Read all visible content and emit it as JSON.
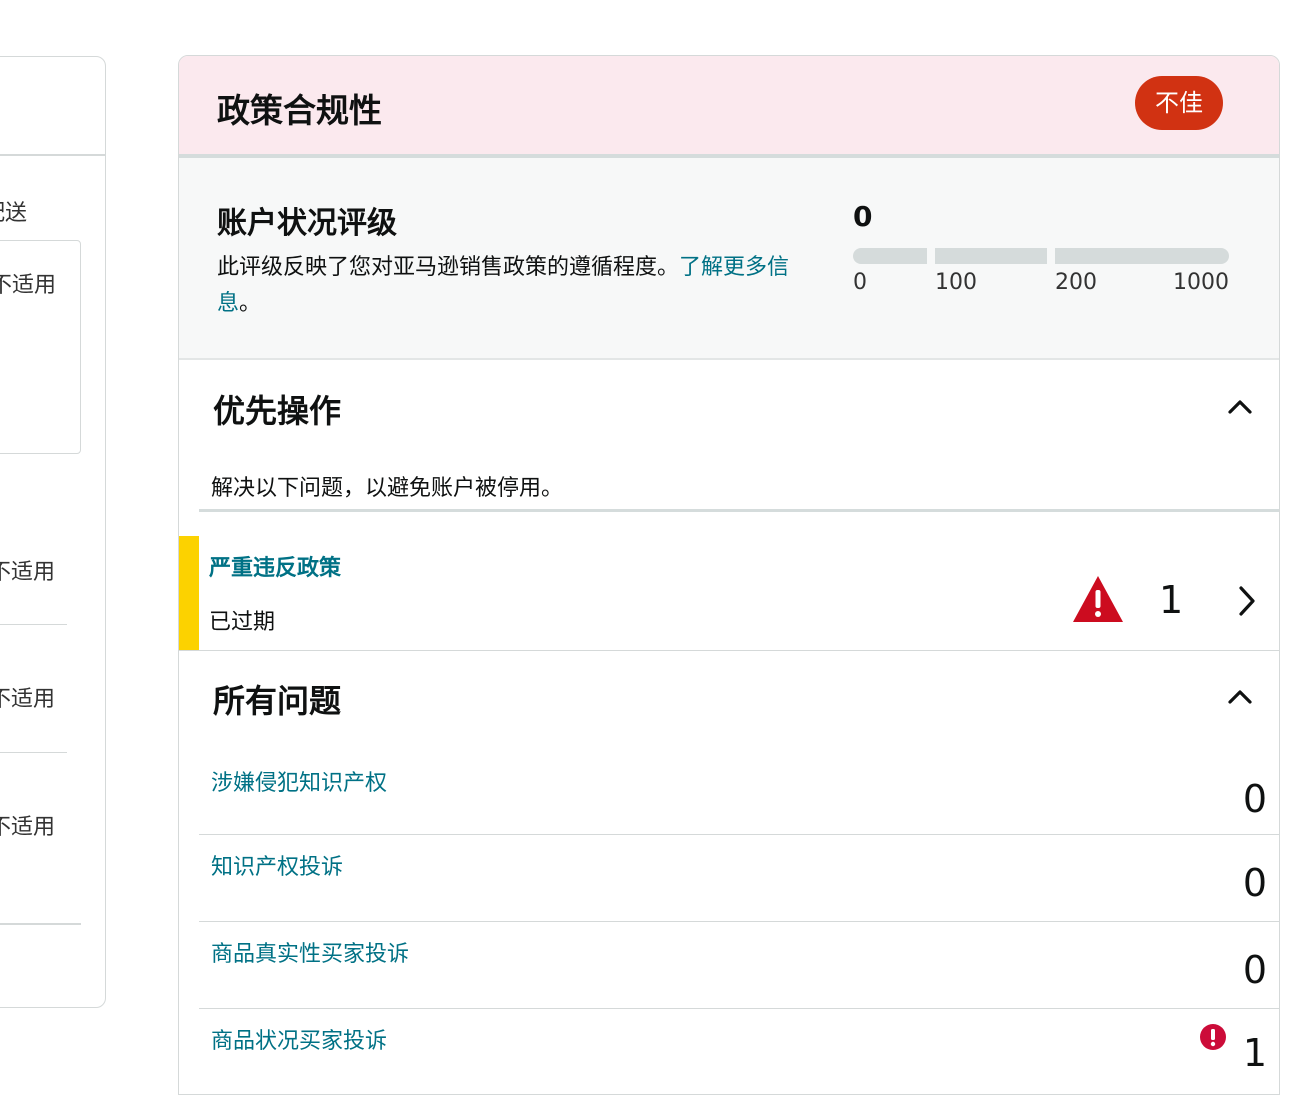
{
  "left_panel": {
    "labels": [
      "逊配送",
      "不适用",
      "不适用",
      "不适用",
      "不适用"
    ]
  },
  "policy": {
    "title": "政策合规性",
    "status_badge": "不佳",
    "status_color": "#d13212"
  },
  "rating": {
    "title": "账户状况评级",
    "description": "此评级反映了您对亚马逊销售政策的遵循程度。",
    "link_text": "了解更多信息",
    "link_suffix": "。",
    "score": "0",
    "ticks": [
      "0",
      "100",
      "200",
      "1000"
    ]
  },
  "priority": {
    "title": "优先操作",
    "description": "解决以下问题，以避免账户被停用。",
    "item": {
      "label": "严重违反政策",
      "status": "已过期",
      "count": "1",
      "icon": "warning-triangle-icon",
      "accent_color": "#fcd200"
    }
  },
  "all_issues": {
    "title": "所有问题",
    "items": [
      {
        "label": "涉嫌侵犯知识产权",
        "value": "0"
      },
      {
        "label": "知识产权投诉",
        "value": "0"
      },
      {
        "label": "商品真实性买家投诉",
        "value": "0"
      },
      {
        "label": "商品状况买家投诉",
        "value": "1",
        "icon": "alert-circle-icon"
      }
    ]
  },
  "colors": {
    "link": "#007185",
    "header_bg": "#fbe9ee",
    "danger": "#d13212"
  }
}
